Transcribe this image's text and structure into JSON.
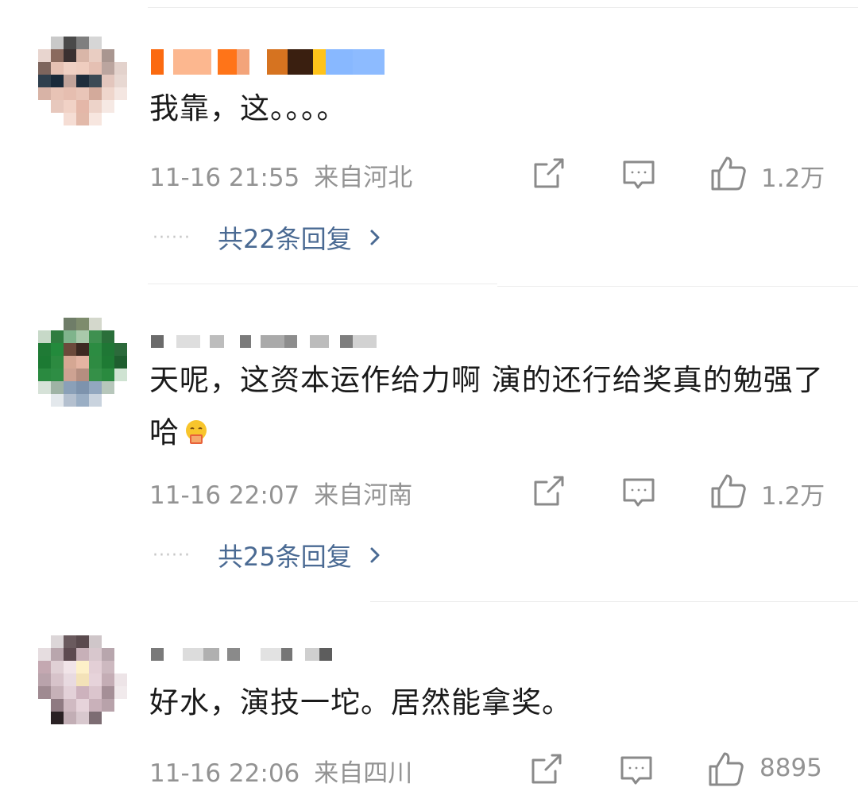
{
  "comments": [
    {
      "text": "我靠，这。。。。",
      "time": "11-16 21:55",
      "location": "来自河北",
      "likes": "1.2万",
      "replies": "共22条回复",
      "name_colors": [
        "#fb6a10",
        "#fcb78f",
        "#ff7418",
        "#f3a47a",
        "#d67320",
        "#3a1f10",
        "#ffc31a",
        "#88b8ff",
        "#8dbbff"
      ],
      "avatar_colors": [
        "#ffffff",
        "#c9c9c9",
        "#4a4a4a",
        "#7f7f7f",
        "#d6d6d6",
        "#ffffff",
        "#ffffff",
        "#e8d5cf",
        "#8a6a5e",
        "#3a3030",
        "#d9b6a8",
        "#e9cdc2",
        "#a99690",
        "#ffffff",
        "#7d655d",
        "#e6c1b3",
        "#f0d0c3",
        "#efcdbf",
        "#e5c0b3",
        "#bba59f",
        "#e3d2cc",
        "#2f3f4d",
        "#1a2a3a",
        "#c1a39a",
        "#1e2d3c",
        "#3c4a55",
        "#e3c6bd",
        "#e8d8d2",
        "#d8b3a6",
        "#e8c3b5",
        "#e6beb0",
        "#e9c5b8",
        "#d3aa9b",
        "#efd6cc",
        "#f4e6e1",
        "#ffffff",
        "#e7c8bd",
        "#f1d2c6",
        "#e4b7a8",
        "#edd3c9",
        "#f6e9e4",
        "#ffffff",
        "#ffffff",
        "#ffffff",
        "#f5ddd4",
        "#e2b9a9",
        "#f7e6df",
        "#ffffff",
        "#ffffff"
      ]
    },
    {
      "text": "天呢，这资本运作给力啊 演的还行给奖真的勉强了哈",
      "time": "11-16 22:07",
      "location": "来自河南",
      "likes": "1.2万",
      "replies": "共25条回复",
      "name_colors": [
        "#6b6b6b",
        "#dedede",
        "#bdbdbd",
        "#7b7b7b",
        "#aaaaaa",
        "#8d8d8d",
        "#bcbcbc",
        "#7e7e7e",
        "#d2d2d2"
      ],
      "avatar_colors": [
        "#ffffff",
        "#ffffff",
        "#6f7d68",
        "#7e8c6d",
        "#d4d8cc",
        "#ffffff",
        "#ffffff",
        "#c7d9c8",
        "#2f7c3f",
        "#7fb48c",
        "#a9c9ab",
        "#3f9050",
        "#2a6f3a",
        "#ffffff",
        "#1f7a35",
        "#238a3c",
        "#6b4a3b",
        "#3d2a22",
        "#2c8c42",
        "#1f7735",
        "#2c6a3b",
        "#1c7a33",
        "#2c8a40",
        "#d5a793",
        "#e4b4a2",
        "#2e8b42",
        "#1e7a34",
        "#1f5e2f",
        "#2a8a40",
        "#2e8d44",
        "#cda292",
        "#b58e80",
        "#359048",
        "#2a8a3f",
        "#cfe3d2",
        "#d6e2d8",
        "#9fb3a5",
        "#8aa0b8",
        "#7d93ad",
        "#92a7bf",
        "#b7c7bb",
        "#ffffff",
        "#ffffff",
        "#e3e8ec",
        "#b4c0cf",
        "#9aaec4",
        "#c9d3de",
        "#ffffff",
        "#ffffff"
      ]
    },
    {
      "text": "好水，演技一坨。居然能拿奖。",
      "time": "11-16 22:06",
      "location": "来自四川",
      "likes": "8895",
      "name_colors": [
        "#7a7a7a",
        "#dcdcdc",
        "#b0b0b0",
        "#8a8a8a",
        "#e2e2e2",
        "#767676",
        "#cfcfcf",
        "#5d5d5d"
      ],
      "avatar_colors": [
        "#ffffff",
        "#dcd6d8",
        "#6a5a5e",
        "#5a4a4e",
        "#cfc6c9",
        "#ffffff",
        "#ffffff",
        "#e6dde0",
        "#b9a6ad",
        "#5d4a50",
        "#c7b0b8",
        "#d8c7cd",
        "#b8a6ad",
        "#ffffff",
        "#c4a8b1",
        "#e0d0d5",
        "#f1e4e8",
        "#fdf0c8",
        "#e3cfd6",
        "#cdb9c0",
        "#ffffff",
        "#b9a3ab",
        "#d7c3ca",
        "#e8dae0",
        "#f3e2b8",
        "#e6d3da",
        "#c4adb5",
        "#ede4e7",
        "#9f8a91",
        "#c6b1b8",
        "#e3d1d8",
        "#cdb2bd",
        "#dbc5cd",
        "#a58f97",
        "#f1eaec",
        "#ffffff",
        "#8f7a82",
        "#d0bac2",
        "#e6d3da",
        "#c9b1ba",
        "#b8a2aa",
        "#ffffff",
        "#ffffff",
        "#2a2124",
        "#c2aeb5",
        "#d8c8ce",
        "#7d6d73",
        "#ffffff",
        "#ffffff"
      ]
    }
  ],
  "colors": {
    "text": "#1a1a1a",
    "meta": "#939393",
    "link": "#4a6a93",
    "divider": "#ececec"
  },
  "icons": [
    "share-icon",
    "comment-icon",
    "like-icon",
    "chevron-right-icon"
  ]
}
